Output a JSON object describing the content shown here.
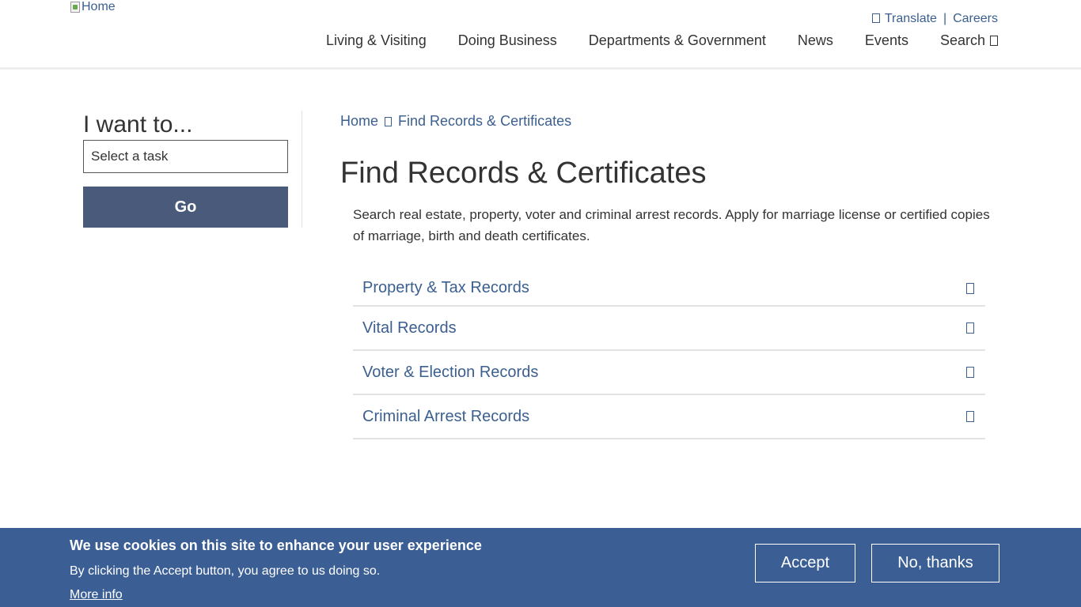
{
  "header": {
    "logo_alt": "Home",
    "utility": {
      "translate": "Translate",
      "separator": "|",
      "careers": "Careers"
    },
    "nav": [
      "Living & Visiting",
      "Doing Business",
      "Departments & Government",
      "News",
      "Events"
    ],
    "search_label": "Search"
  },
  "sidebar": {
    "heading": "I want to...",
    "select_value": "Select a task",
    "go_label": "Go"
  },
  "breadcrumb": {
    "home": "Home",
    "current": "Find Records & Certificates"
  },
  "main": {
    "title": "Find Records & Certificates",
    "intro": "Search real estate, property, voter and criminal arrest records. Apply for marriage license or certified copies of marriage, birth and death certificates.",
    "accordion": [
      "Property & Tax Records",
      "Vital Records",
      "Voter & Election Records",
      "Criminal Arrest Records"
    ]
  },
  "cookie": {
    "title": "We use cookies on this site to enhance your user experience",
    "text": "By clicking the Accept button, you agree to us doing so.",
    "more": "More info",
    "accept": "Accept",
    "decline": "No, thanks"
  },
  "colors": {
    "link": "#3b5f8f",
    "go_button": "#4a5a7a",
    "cookie_bg": "#3b5f95"
  }
}
